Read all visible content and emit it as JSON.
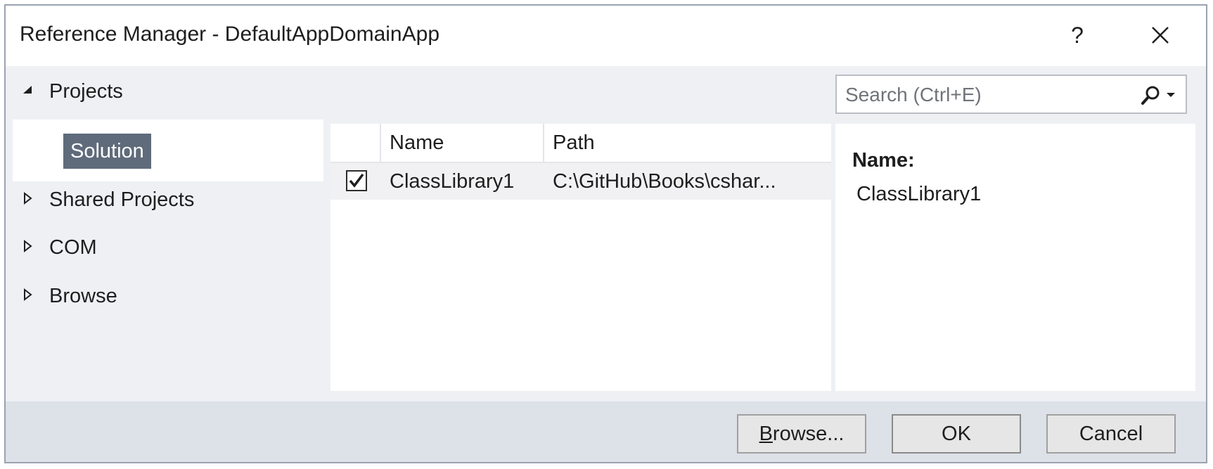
{
  "window": {
    "title": "Reference Manager - DefaultAppDomainApp",
    "help_label": "?"
  },
  "tree": {
    "items": [
      {
        "label": "Projects",
        "expanded": true
      },
      {
        "label": "Solution",
        "selected": true
      },
      {
        "label": "Shared Projects",
        "expanded": false
      },
      {
        "label": "COM",
        "expanded": false
      },
      {
        "label": "Browse",
        "expanded": false
      }
    ]
  },
  "search": {
    "placeholder": "Search (Ctrl+E)",
    "icon": "search-icon"
  },
  "list": {
    "columns": [
      "Name",
      "Path"
    ],
    "rows": [
      {
        "checked": true,
        "name": "ClassLibrary1",
        "path": "C:\\GitHub\\Books\\cshar..."
      }
    ]
  },
  "details": {
    "label": "Name:",
    "value": "ClassLibrary1"
  },
  "footer": {
    "browse_hotkey": "B",
    "browse_rest": "rowse...",
    "ok_label": "OK",
    "cancel_label": "Cancel"
  },
  "colors": {
    "selection": "#5f6b7a",
    "footer": "#dde1e8",
    "dialog_bg": "#eef0f4"
  }
}
